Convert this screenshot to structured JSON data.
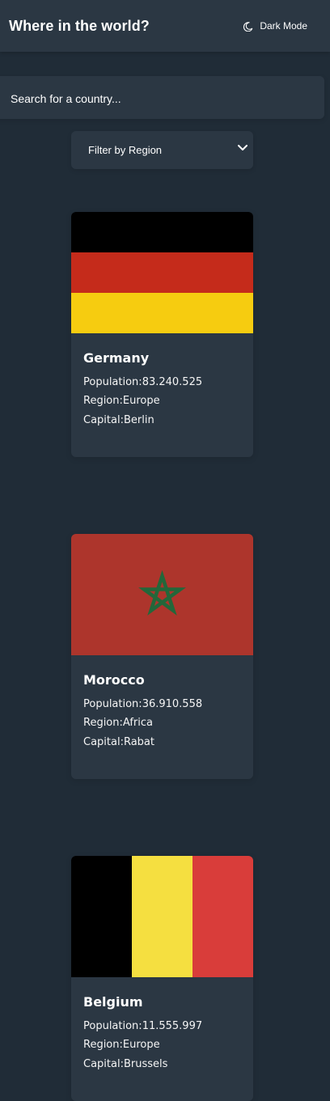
{
  "header": {
    "title": "Where in the world?",
    "mode_toggle_label": "Dark Mode",
    "mode_toggle_icon": "moon-icon"
  },
  "search": {
    "placeholder": "Search for a country...",
    "value": "",
    "icon": "none"
  },
  "filter": {
    "label": "Filter by Region",
    "icon": "chevron-down-icon"
  },
  "labels": {
    "population": "Population:",
    "region": "Region:",
    "capital": "Capital:"
  },
  "countries": [
    {
      "name": "Germany",
      "population": "83.240.525",
      "region": "Europe",
      "capital": "Berlin",
      "flag": "germany-flag"
    },
    {
      "name": "Morocco",
      "population": "36.910.558",
      "region": "Africa",
      "capital": "Rabat",
      "flag": "morocco-flag"
    },
    {
      "name": "Belgium",
      "population": "11.555.997",
      "region": "Europe",
      "capital": "Brussels",
      "flag": "belgium-flag"
    }
  ],
  "colors": {
    "background": "#202c37",
    "surface": "#2b3743",
    "text": "#ffffff",
    "germany_black": "#000000",
    "germany_red": "#c52b1b",
    "germany_gold": "#f6cc10",
    "morocco_red": "#ad352c",
    "morocco_green": "#23673a",
    "belgium_black": "#000000",
    "belgium_yellow": "#f5df40",
    "belgium_red": "#d93d3a"
  }
}
